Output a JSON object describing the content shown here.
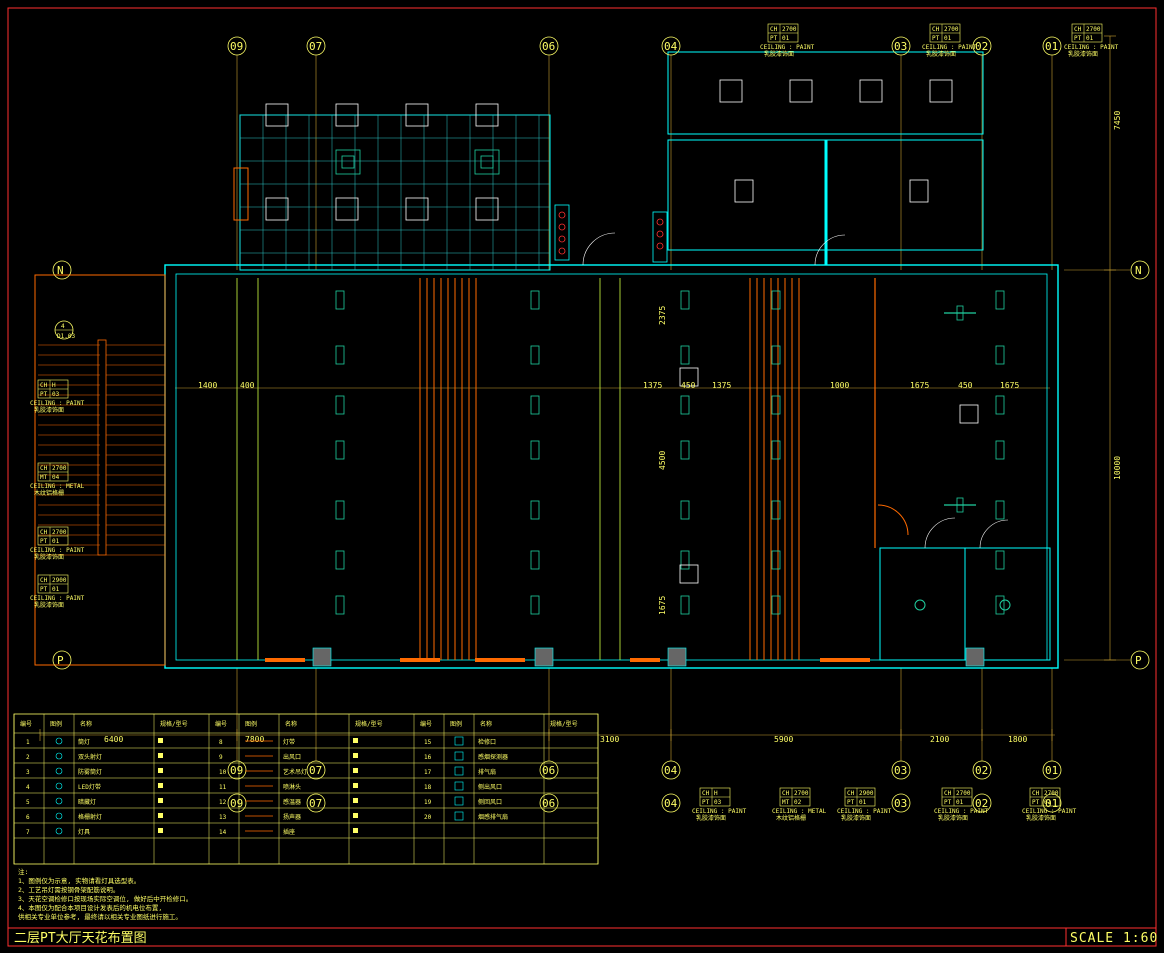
{
  "title": "二层PT大厅天花布置图",
  "scale": "SCALE 1:60",
  "axes_top": [
    "09",
    "07",
    "06",
    "04",
    "03",
    "02",
    "01"
  ],
  "axes_bottom": [
    "09",
    "07",
    "06",
    "04",
    "03",
    "02",
    "01"
  ],
  "axis_rows": [
    "N",
    "P"
  ],
  "dims_right": [
    "7450",
    "10000"
  ],
  "dims_bottom": [
    "6400",
    "7800",
    "3100",
    "5900",
    "2100",
    "1800"
  ],
  "dims_inner": [
    "1400",
    "400",
    "1375",
    "450",
    "1375",
    "1000",
    "1675",
    "450",
    "1675",
    "4500",
    "2375",
    "1675"
  ],
  "ceiling_tags": [
    {
      "ch": "CH",
      "ch_val": "2700",
      "code": "PT",
      "code_val": "01",
      "cap": "CEILING : PAINT",
      "sub": "乳胶漆饰面"
    },
    {
      "ch": "CH",
      "ch_val": "2700",
      "code": "PT",
      "code_val": "01",
      "cap": "CEILING : PAINT",
      "sub": "乳胶漆饰面"
    },
    {
      "ch": "CH",
      "ch_val": "2700",
      "code": "PT",
      "code_val": "01",
      "cap": "CEILING : PAINT",
      "sub": "乳胶漆饰面"
    },
    {
      "ch": "CH",
      "ch_val": "H",
      "code": "PT",
      "code_val": "03",
      "cap": "CEILING : PAINT",
      "sub": "乳胶漆饰面"
    },
    {
      "ch": "CH",
      "ch_val": "2700",
      "code": "MT",
      "code_val": "04",
      "cap": "CEILING : METAL",
      "sub": "木纹铝格栅"
    },
    {
      "ch": "CH",
      "ch_val": "2700",
      "code": "PT",
      "code_val": "01",
      "cap": "CEILING : PAINT",
      "sub": "乳胶漆饰面"
    },
    {
      "ch": "CH",
      "ch_val": "2900",
      "code": "PT",
      "code_val": "01",
      "cap": "CEILING : PAINT",
      "sub": "乳胶漆饰面"
    },
    {
      "ch": "CH",
      "ch_val": "H",
      "code": "PT",
      "code_val": "03",
      "cap": "CEILING : PAINT",
      "sub": "乳胶漆饰面"
    },
    {
      "ch": "CH",
      "ch_val": "2700",
      "code": "MT",
      "code_val": "02",
      "cap": "CEILING : METAL",
      "sub": "木纹铝格栅"
    },
    {
      "ch": "CH",
      "ch_val": "2900",
      "code": "PT",
      "code_val": "01",
      "cap": "CEILING : PAINT",
      "sub": "乳胶漆饰面"
    },
    {
      "ch": "CH",
      "ch_val": "2700",
      "code": "PT",
      "code_val": "01",
      "cap": "CEILING : PAINT",
      "sub": "乳胶漆饰面"
    },
    {
      "ch": "CH",
      "ch_val": "2700",
      "code": "PT",
      "code_val": "01",
      "cap": "CEILING : PAINT",
      "sub": "乳胶漆饰面"
    }
  ],
  "section_mark": {
    "num": "4",
    "ref": "D1.03"
  },
  "legend": {
    "headers": [
      "编号",
      "图例",
      "名称",
      "规格/型号",
      "编号",
      "图例",
      "名称",
      "规格/型号",
      "编号",
      "图例",
      "名称",
      "规格/型号"
    ],
    "rows": [
      [
        "1",
        "筒灯",
        "",
        "8",
        "灯带",
        "",
        "15",
        "检修口"
      ],
      [
        "2",
        "双头射灯",
        "",
        "9",
        "出风口",
        "",
        "16",
        "感烟探测器"
      ],
      [
        "3",
        "防雾筒灯",
        "",
        "10",
        "艺术吊灯",
        "",
        "17",
        "排气扇"
      ],
      [
        "4",
        "LED灯带",
        "",
        "11",
        "喷淋头",
        "",
        "18",
        "侧出风口"
      ],
      [
        "5",
        "暗藏灯",
        "",
        "12",
        "感温器",
        "",
        "19",
        "侧回风口"
      ],
      [
        "6",
        "格栅射灯",
        "",
        "13",
        "扬声器",
        "",
        "20",
        "烟感排气扇"
      ],
      [
        "7",
        "灯具",
        "",
        "14",
        "插座",
        ""
      ]
    ]
  },
  "notes": [
    "注:",
    "1、图例仅为示意, 实物请看灯具选型表。",
    "2、工艺吊灯需按钢骨架配筋说明。",
    "3、天花空调检修口按现场实际空调位, 做好后中开检修口。",
    "4、本图仅为配合本项目设计发表后的机电位布置,",
    "   供相关专业单位参考, 最终请以相关专业图纸进行施工。"
  ],
  "colors": {
    "bg": "#000000",
    "border": "#ff3030",
    "wall": "#00ffff",
    "text": "#ffff66",
    "dim": "#c8a032",
    "orange": "#ff6a00",
    "fixture": "#20d0a0",
    "grid": "#2cc8c8",
    "door": "#ffffff"
  }
}
